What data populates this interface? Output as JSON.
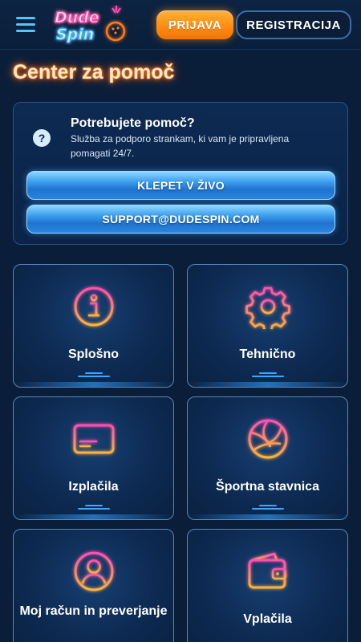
{
  "header": {
    "logo_text": "Dude Spin",
    "login_label": "PRIJAVA",
    "register_label": "REGISTRACIJA"
  },
  "page": {
    "title": "Center za pomoč"
  },
  "help": {
    "title": "Potrebujete pomoč?",
    "description": "Služba za podporo strankam, ki vam je pripravljena pomagati 24/7.",
    "chat_label": "KLEPET V ŽIVO",
    "email_label": "SUPPORT@DUDESPIN.COM"
  },
  "categories": [
    {
      "label": "Splošno",
      "icon": "info-icon"
    },
    {
      "label": "Tehnično",
      "icon": "gear-icon"
    },
    {
      "label": "Izplačila",
      "icon": "card-icon"
    },
    {
      "label": "Športna stavnica",
      "icon": "ball-icon"
    },
    {
      "label": "Moj račun in preverjanje",
      "icon": "user-icon"
    },
    {
      "label": "Vplačila",
      "icon": "wallet-icon"
    }
  ],
  "colors": {
    "background": "#0a1e3a",
    "accent_orange": "#ff8a12",
    "accent_blue": "#3ea2f0",
    "neon_orange": "#ff7a1a",
    "neon_pink": "#ff4fb0"
  }
}
